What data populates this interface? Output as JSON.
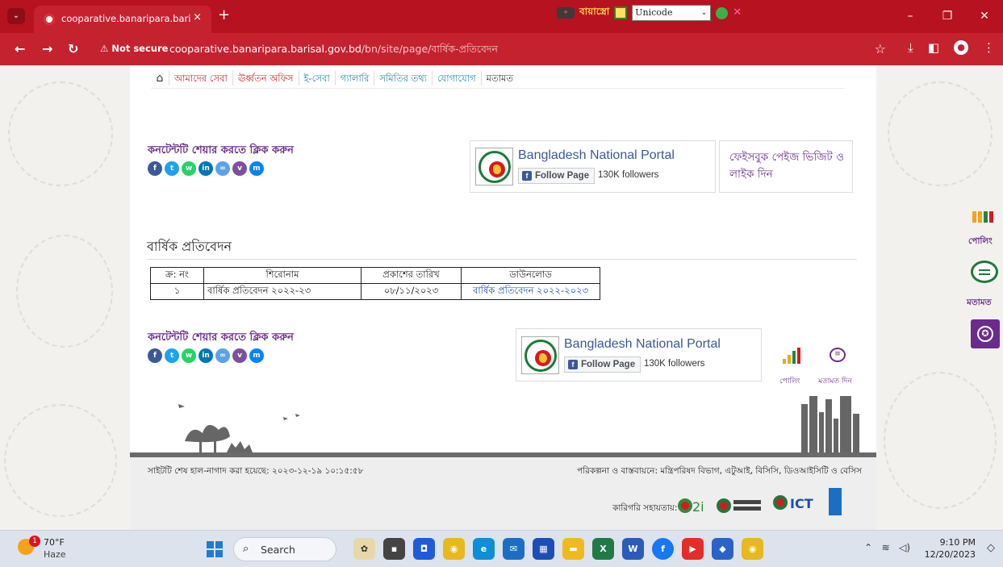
{
  "browser": {
    "tab_title": "cooparative.banaripara.barisal.g",
    "tab_close": "×",
    "new_tab": "+",
    "ime_label": "বায়াস্ত্রো",
    "ime_encoding": "Unicode",
    "security_label": "⚠ Not secure",
    "url_host": "cooparative.banaripara.barisal.gov.bd",
    "url_path": "/bn/site/page/বার্ষিক-প্রতিবেদন",
    "star": "☆"
  },
  "menu": {
    "items": [
      "আমাদের সেবা",
      "ঊর্ধ্বতন অফিস",
      "ই-সেবা",
      "গ্যালারি",
      "সমিতির তথ্য",
      "যোগাযোগ",
      "মতামত"
    ]
  },
  "share": {
    "title": "কনটেন্টটি শেয়ার করতে ক্লিক করুন",
    "icons": [
      "facebook-icon",
      "twitter-icon",
      "whatsapp-icon",
      "linkedin-icon",
      "copy-link-icon",
      "viber-icon",
      "messenger-icon"
    ]
  },
  "portal": {
    "name": "Bangladesh National Portal",
    "follow_label": "Follow Page",
    "followers": "130K followers"
  },
  "fb_visit": "ফেইসবুক পেইজ ভিজিট ও লাইক দিন",
  "page_title": "বার্ষিক প্রতিবেদন",
  "table": {
    "headers": [
      "ক্র: নং",
      "শিরোনাম",
      "প্রকাশের তারিখ",
      "ডাউনলোড"
    ],
    "rows": [
      [
        "১",
        "বার্ষিক প্রতিবেদন ২০২২-২৩",
        "০৮/১১/২০২৩",
        "বার্ষিক প্রতিবেদন ২০২২-২০২৩"
      ]
    ]
  },
  "widgets": {
    "poll_label": "পোলিং",
    "feedback_label": "মতামত দিন",
    "side_poll_label": "পোলিং",
    "side_feedback_label": "মতামত"
  },
  "footer": {
    "last_updated": "সাইটটি শেষ হাল-নাগাদ করা হয়েছে: ২০২৩-১২-১৯ ১০:১৫:৫৮",
    "implementation": "পরিকল্পনা ও বাস্তবায়নে: মন্ত্রিপরিষদ বিভাগ, এটুআই, বিসিসি, ডিওআইসিটি ও বেসিস",
    "tech_support": "কারিগরি সহায়তায়:",
    "logos": [
      "a2i",
      "Cabinet Division",
      "ICT DIVISION",
      "UNDP"
    ]
  },
  "taskbar": {
    "weather_badge": "1",
    "temperature": "70°F",
    "condition": "Haze",
    "search_placeholder": "Search",
    "time": "9:10 PM",
    "date": "12/20/2023"
  },
  "colors": {
    "chrome_red": "#b7121f",
    "accent_purple": "#6b2b8c",
    "menu_red": "#d0242b",
    "menu_teal": "#1e8aa6",
    "fb_blue": "#3b5998"
  }
}
